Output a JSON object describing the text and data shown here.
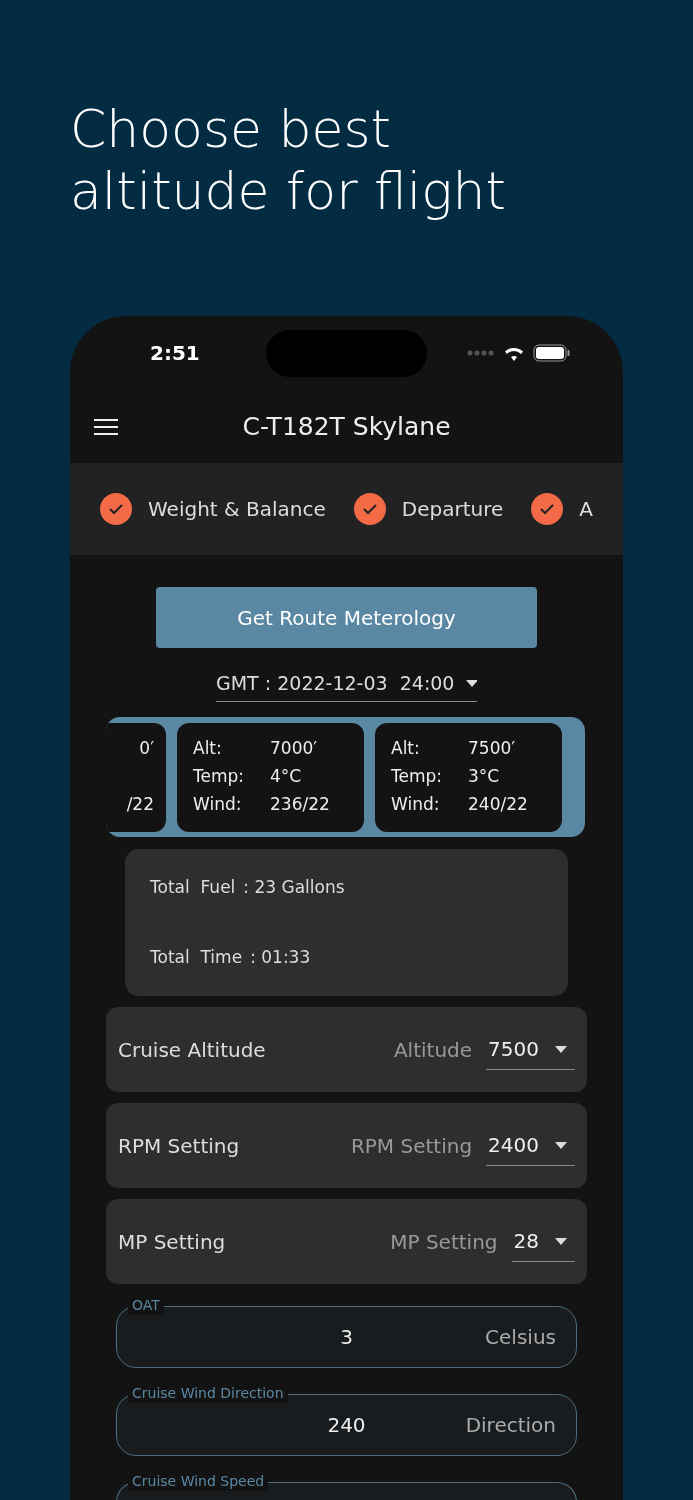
{
  "headline": "Choose best altitude for flight",
  "status_bar": {
    "time": "2:51"
  },
  "app_bar": {
    "title": "C-T182T Skylane"
  },
  "steps": [
    {
      "label": "Weight & Balance",
      "checked": true
    },
    {
      "label": "Departure",
      "checked": true
    },
    {
      "label": "A",
      "checked": true
    }
  ],
  "route_button": "Get Route Meterology",
  "gmt_select": {
    "value": "GMT : 2022-12-03  24:00"
  },
  "altitude_cards": [
    {
      "rows": [
        {
          "label": "",
          "value": "0′"
        },
        {
          "label": "",
          "value": ""
        },
        {
          "label": "",
          "value": "/22"
        }
      ]
    },
    {
      "rows": [
        {
          "label": "Alt:",
          "value": "7000′"
        },
        {
          "label": "Temp:",
          "value": "4°C"
        },
        {
          "label": "Wind:",
          "value": "236/22"
        }
      ]
    },
    {
      "rows": [
        {
          "label": "Alt:",
          "value": "7500′"
        },
        {
          "label": "Temp:",
          "value": "3°C"
        },
        {
          "label": "Wind:",
          "value": "240/22"
        }
      ]
    }
  ],
  "totals": [
    {
      "label": "Total  Fuel",
      "value": ": 23 Gallons"
    },
    {
      "label": "Total  Time",
      "value": ": 01:33"
    }
  ],
  "settings": [
    {
      "label": "Cruise Altitude",
      "hint": "Altitude",
      "value": "7500"
    },
    {
      "label": "RPM Setting",
      "hint": "RPM Setting",
      "value": "2400"
    },
    {
      "label": "MP Setting",
      "hint": "MP Setting",
      "value": "28"
    }
  ],
  "fields": [
    {
      "label": "OAT",
      "value": "3",
      "unit": "Celsius"
    },
    {
      "label": "Cruise Wind Direction",
      "value": "240",
      "unit": "Direction"
    },
    {
      "label": "Cruise Wind Speed"
    }
  ]
}
